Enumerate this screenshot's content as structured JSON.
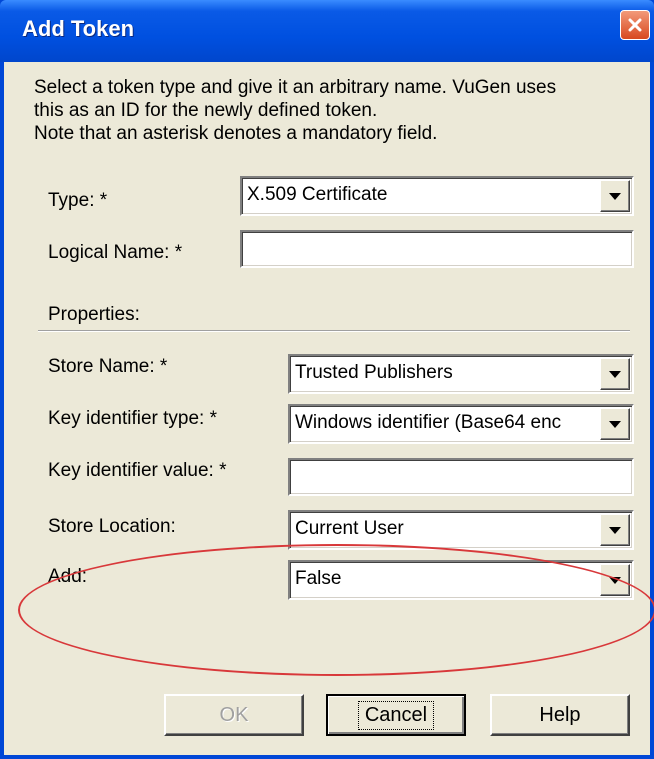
{
  "window": {
    "title": "Add Token",
    "colors": {
      "titlebar": "#0050e0",
      "client": "#ece9d8",
      "annotation": "#d8383a"
    }
  },
  "intro": {
    "line1": "Select a token type and give it an arbitrary name. VuGen uses",
    "line2": "this as an ID for the newly defined token.",
    "line3": "Note that an asterisk denotes a mandatory field."
  },
  "type": {
    "label": "Type: *",
    "value": "X.509 Certificate"
  },
  "logical_name": {
    "label": "Logical Name: *",
    "value": ""
  },
  "properties": {
    "label": "Properties:"
  },
  "store_name": {
    "label": "Store Name: *",
    "value": "Trusted Publishers"
  },
  "key_identifier_type": {
    "label": "Key identifier type: *",
    "value": "Windows identifier (Base64 enc"
  },
  "key_identifier_value": {
    "label": "Key identifier value: *",
    "value": ""
  },
  "store_location": {
    "label": "Store Location:",
    "value": "Current User"
  },
  "add": {
    "label": "Add:",
    "value": "False"
  },
  "buttons": {
    "ok": "OK",
    "cancel": "Cancel",
    "help": "Help"
  }
}
